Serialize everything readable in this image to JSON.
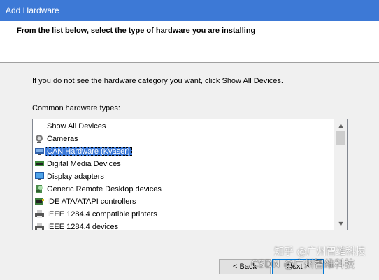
{
  "window": {
    "title": "Add Hardware"
  },
  "header": {
    "heading": "From the list below, select the type of hardware you are installing"
  },
  "content": {
    "instruction": "If you do not see the hardware category you want, click Show All Devices.",
    "list_label": "Common hardware types:"
  },
  "list": {
    "items": [
      {
        "label": "Show All Devices",
        "icon": "none",
        "selected": false
      },
      {
        "label": "Cameras",
        "icon": "camera-icon",
        "selected": false
      },
      {
        "label": "CAN Hardware (Kvaser)",
        "icon": "can-hardware-icon",
        "selected": true
      },
      {
        "label": "Digital Media Devices",
        "icon": "digital-media-icon",
        "selected": false
      },
      {
        "label": "Display adapters",
        "icon": "display-adapter-icon",
        "selected": false
      },
      {
        "label": "Generic Remote Desktop devices",
        "icon": "remote-desktop-icon",
        "selected": false
      },
      {
        "label": "IDE ATA/ATAPI controllers",
        "icon": "ide-controller-icon",
        "selected": false
      },
      {
        "label": "IEEE 1284.4 compatible printers",
        "icon": "printer-icon",
        "selected": false
      },
      {
        "label": "IEEE 1284.4 devices",
        "icon": "printer-icon",
        "selected": false
      }
    ]
  },
  "footer": {
    "back_label": "< Back",
    "next_label": "Next >",
    "watermark": "CSDN @广州智维科技",
    "watermark_top": "知乎 @广州智维科技"
  },
  "colors": {
    "titlebar": "#3d79d6",
    "selection": "#3a78d8"
  }
}
